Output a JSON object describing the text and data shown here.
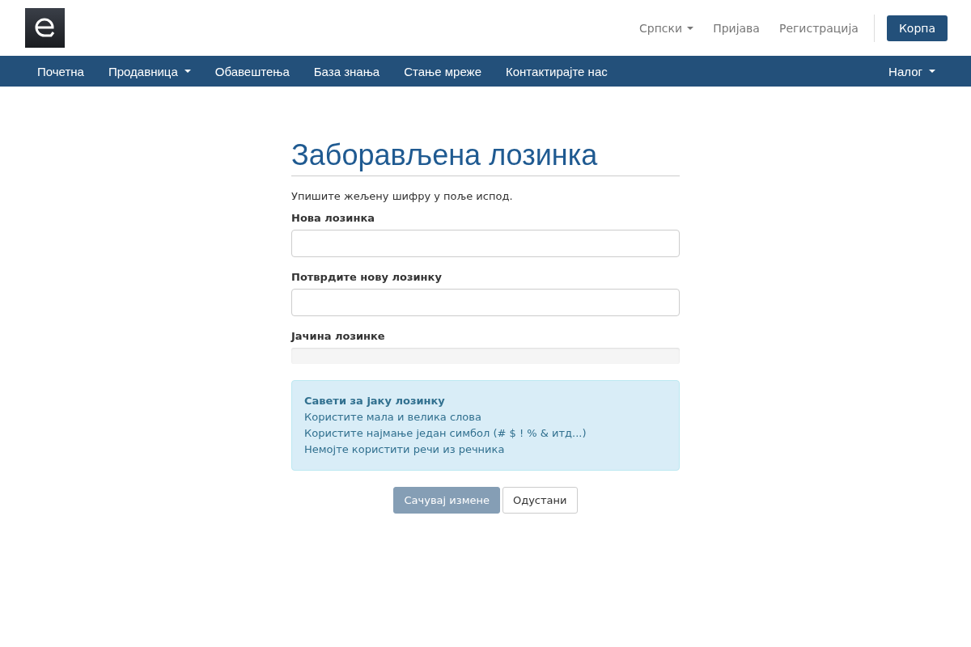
{
  "header": {
    "links": [
      {
        "label": "Српски",
        "dropdown": true
      },
      {
        "label": "Пријава",
        "dropdown": false
      },
      {
        "label": "Регистрација",
        "dropdown": false
      }
    ],
    "cart_button": "Корпа"
  },
  "navbar": {
    "items": [
      {
        "label": "Почетна",
        "dropdown": false
      },
      {
        "label": "Продавница",
        "dropdown": true
      },
      {
        "label": "Обавештења",
        "dropdown": false
      },
      {
        "label": "База знања",
        "dropdown": false
      },
      {
        "label": "Стање мреже",
        "dropdown": false
      },
      {
        "label": "Контактирајте нас",
        "dropdown": false
      }
    ],
    "account": {
      "label": "Налог",
      "dropdown": true
    }
  },
  "form": {
    "title": "Заборављена лозинка",
    "intro": "Упишите жељену шифру у поље испод.",
    "fields": [
      {
        "label": "Нова лозинка"
      },
      {
        "label": "Потврдите нову лозинку"
      }
    ],
    "strength": {
      "label": "Јачина лозинке"
    },
    "tips": {
      "title": "Савети за јаку лозинку",
      "lines": [
        "Користите мала и велика слова",
        "Користите најмање један симбол (# $ ! % & итд...)",
        "Немојте користити речи из речника"
      ]
    },
    "buttons": [
      {
        "label": "Сачувај измене",
        "kind": "primary",
        "disabled": true
      },
      {
        "label": "Одустани",
        "kind": "default",
        "disabled": false
      }
    ]
  }
}
